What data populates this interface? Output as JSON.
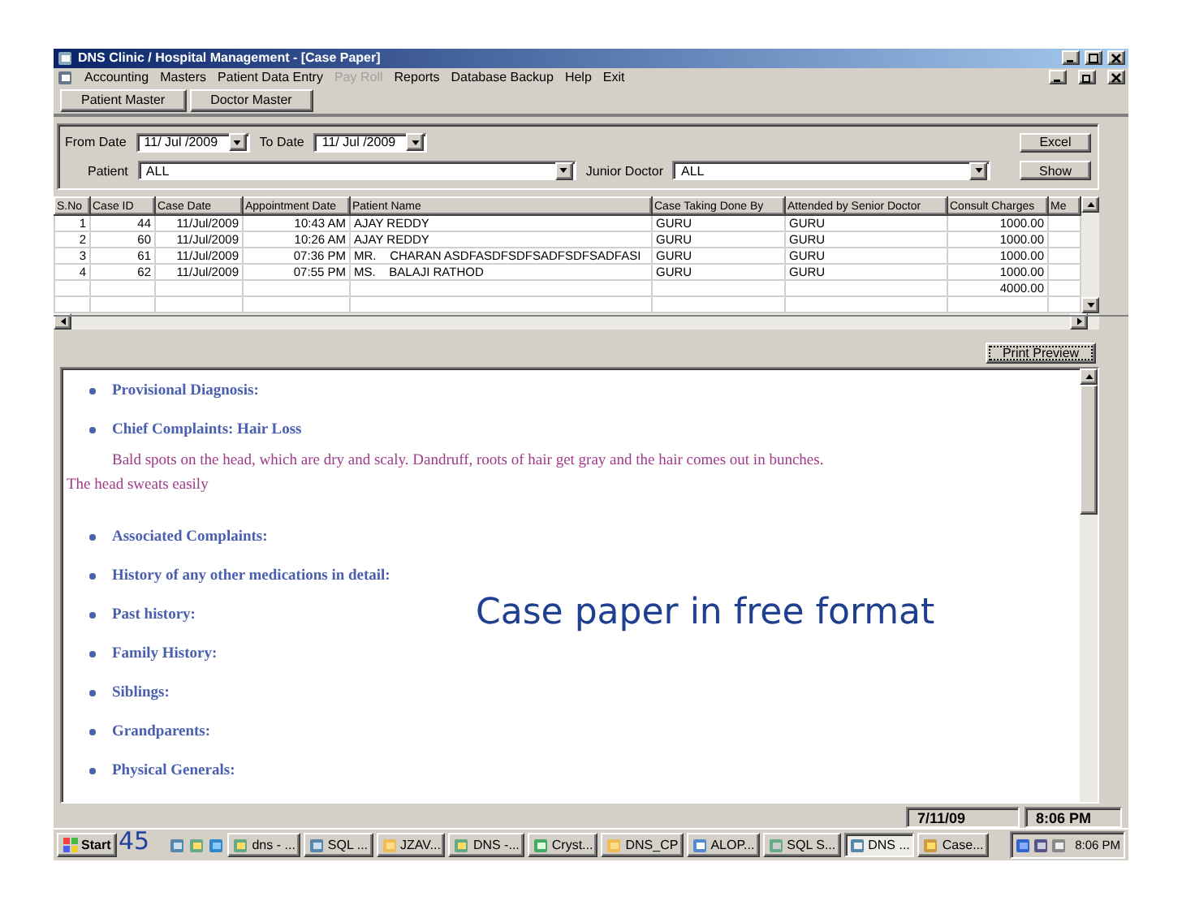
{
  "window": {
    "title": "DNS Clinic / Hospital Management - [Case Paper]"
  },
  "menu": [
    {
      "label": "Accounting",
      "disabled": false
    },
    {
      "label": "Masters",
      "disabled": false
    },
    {
      "label": "Patient Data Entry",
      "disabled": false
    },
    {
      "label": "Pay Roll",
      "disabled": true
    },
    {
      "label": "Reports",
      "disabled": false
    },
    {
      "label": "Database Backup",
      "disabled": false
    },
    {
      "label": "Help",
      "disabled": false
    },
    {
      "label": "Exit",
      "disabled": false
    }
  ],
  "toolbar": [
    "Patient Master",
    "Doctor Master"
  ],
  "filters": {
    "from_date": {
      "label": "From Date",
      "value": "11/ Jul /2009"
    },
    "to_date": {
      "label": "To Date",
      "value": "11/ Jul /2009"
    },
    "patient": {
      "label": "Patient",
      "value": "ALL"
    },
    "junior_doctor": {
      "label": "Junior Doctor",
      "value": "ALL"
    },
    "buttons": [
      "Excel",
      "Show"
    ]
  },
  "table": {
    "columns": [
      "S.No",
      "Case ID",
      "Case Date",
      "Appointment Date",
      "Patient Name",
      "Case Taking Done By",
      "Attended by Senior Doctor",
      "Consult Charges",
      "Me"
    ],
    "rows": [
      {
        "sno": "1",
        "case_id": "44",
        "case_date": "11/Jul/2009",
        "appointment": "10:43 AM",
        "patient": "AJAY REDDY",
        "case_taking": "GURU",
        "senior_doctor": "GURU",
        "charges": "1000.00"
      },
      {
        "sno": "2",
        "case_id": "60",
        "case_date": "11/Jul/2009",
        "appointment": "10:26 AM",
        "patient": "AJAY REDDY",
        "case_taking": "GURU",
        "senior_doctor": "GURU",
        "charges": "1000.00"
      },
      {
        "sno": "3",
        "case_id": "61",
        "case_date": "11/Jul/2009",
        "appointment": "07:36 PM",
        "patient": "MR.    CHARAN ASDFASDFSDFSADFSDFSADFASI",
        "case_taking": "GURU",
        "senior_doctor": "GURU",
        "charges": "1000.00"
      },
      {
        "sno": "4",
        "case_id": "62",
        "case_date": "11/Jul/2009",
        "appointment": "07:55 PM",
        "patient": "MS.    BALAJI RATHOD",
        "case_taking": "GURU",
        "senior_doctor": "GURU",
        "charges": "1000.00"
      },
      {
        "charges": "4000.00"
      }
    ]
  },
  "print_button": "Print Preview",
  "document": [
    {
      "kind": "heading",
      "text": "Provisional Diagnosis:"
    },
    {
      "kind": "heading",
      "text": "Chief Complaints: Hair Loss"
    },
    {
      "kind": "paragraph",
      "text": "Bald spots on the head, which are dry and scaly. Dandruff, roots of hair get gray and the hair comes out in bunches. The head sweats easily"
    },
    {
      "kind": "heading",
      "text": "Associated Complaints:"
    },
    {
      "kind": "heading",
      "text": "History of any other medications in detail:"
    },
    {
      "kind": "heading",
      "text": "Past history:"
    },
    {
      "kind": "heading",
      "text": "Family History:"
    },
    {
      "kind": "heading",
      "text": "Siblings:"
    },
    {
      "kind": "heading",
      "text": "Grandparents:"
    },
    {
      "kind": "heading",
      "text": "Physical Generals:"
    }
  ],
  "status_bar": [
    "7/11/09",
    "8:06 PM"
  ],
  "taskbar": {
    "start": "Start",
    "tasks": [
      {
        "label": "dns - ...",
        "selected": false
      },
      {
        "label": "SQL ...",
        "selected": false
      },
      {
        "label": "JZAV...",
        "selected": false
      },
      {
        "label": "DNS -...",
        "selected": false
      },
      {
        "label": "Cryst...",
        "selected": false
      },
      {
        "label": "DNS_CP",
        "selected": false
      },
      {
        "label": "ALOP...",
        "selected": false
      },
      {
        "label": "SQL S...",
        "selected": false
      },
      {
        "label": "DNS ...",
        "selected": true
      },
      {
        "label": "Case...",
        "selected": false
      }
    ],
    "clock": "8:06 PM"
  },
  "slide": {
    "caption": "Case paper in free format",
    "page_number": "45"
  }
}
